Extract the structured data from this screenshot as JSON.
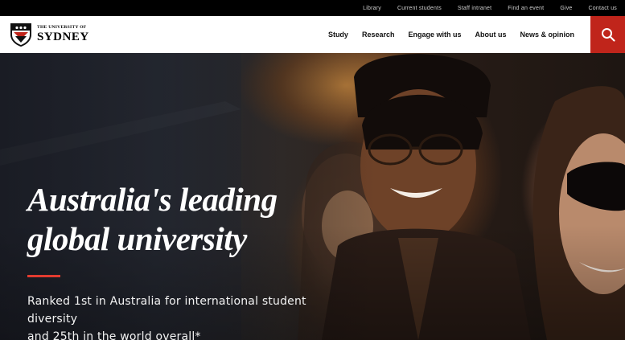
{
  "utility_nav": [
    "Library",
    "Current students",
    "Staff intranet",
    "Find an event",
    "Give",
    "Contact us"
  ],
  "logo": {
    "small_text": "THE UNIVERSITY OF",
    "big_text": "SYDNEY"
  },
  "main_nav": [
    "Study",
    "Research",
    "Engage with us",
    "About us",
    "News & opinion"
  ],
  "search": {
    "icon": "search-icon",
    "bg_color": "#c0251b"
  },
  "hero": {
    "title_line1": "Australia's leading",
    "title_line2": "global university",
    "subtitle_line1": "Ranked 1st in Australia for international student diversity",
    "subtitle_line2": "and 25th in the world overall*",
    "accent_color": "#e23b2f"
  }
}
